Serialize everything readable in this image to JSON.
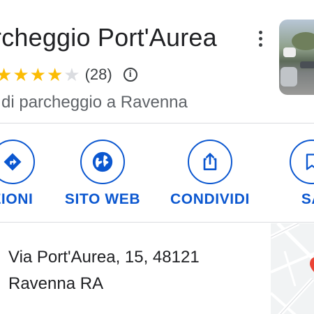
{
  "place": {
    "title": "rcheggio Port'Aurea",
    "rating_count": "(28)",
    "rating_stars": 4,
    "rating_max": 5,
    "category": "di parcheggio a Ravenna"
  },
  "actions": [
    {
      "label": "ZIONI",
      "icon": "directions-icon"
    },
    {
      "label": "SITO WEB",
      "icon": "globe-icon"
    },
    {
      "label": "CONDIVIDI",
      "icon": "share-icon"
    },
    {
      "label": "SA",
      "icon": "bookmark-icon"
    }
  ],
  "address": {
    "line1": "Via Port'Aurea, 15, 48121",
    "line2": "Ravenna RA"
  },
  "colors": {
    "accent": "#0b57d0",
    "star": "#fbbc04",
    "star_empty": "#dadce0",
    "secondary_text": "#5f6368"
  }
}
